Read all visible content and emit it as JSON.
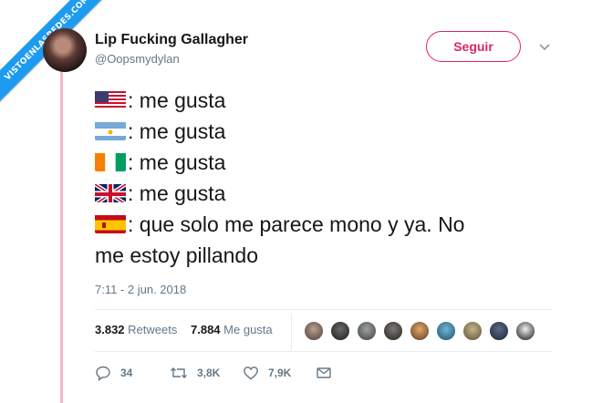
{
  "watermark": {
    "text": "VISTOENLASREDES.COM"
  },
  "user": {
    "name": "Lip Fucking Gallagher",
    "handle": "@Oopsmydylan"
  },
  "follow_button": {
    "label": "Seguir"
  },
  "tweet": {
    "lines": [
      ": me gusta",
      ": me gusta",
      ": me gusta",
      ": me gusta",
      ": que solo me parece mono y ya. No",
      "me estoy pillando"
    ],
    "flags": [
      "us-flag-icon",
      "argentina-flag-icon",
      "ivory-coast-flag-icon",
      "uk-flag-icon",
      "spain-flag-icon"
    ]
  },
  "timestamp": "7:11 - 2 jun. 2018",
  "stats": {
    "retweets_count": "3.832",
    "retweets_label": "Retweets",
    "likes_count": "7.884",
    "likes_label": "Me gusta"
  },
  "actions": {
    "replies": "34",
    "retweets": "3,8K",
    "likes": "7,9K"
  },
  "colors": {
    "accent": "#e0245e",
    "secondary_text": "#657786",
    "ribbon": "#1d9bf0"
  }
}
